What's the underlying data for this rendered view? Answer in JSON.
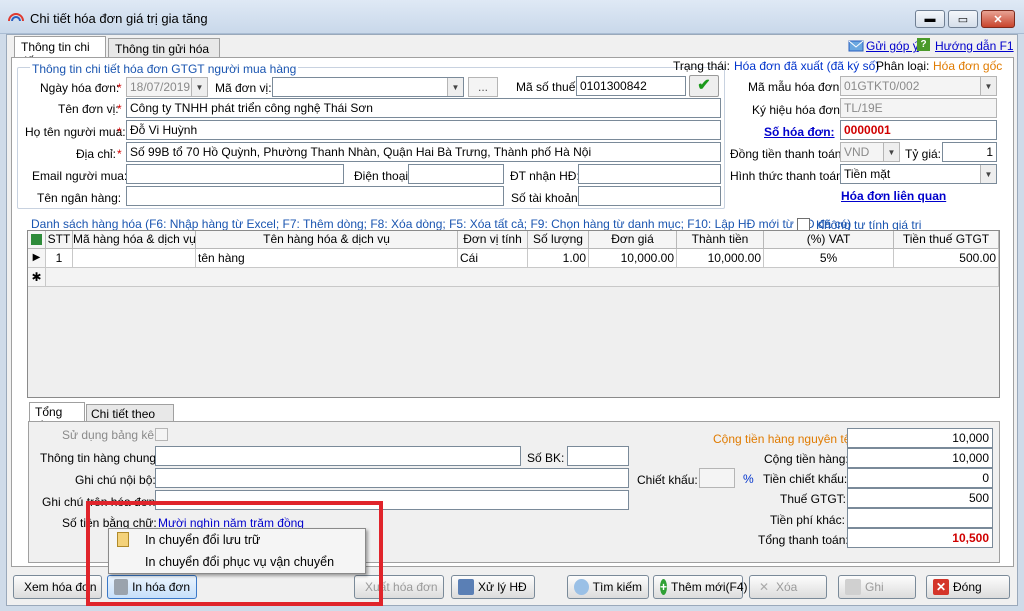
{
  "window": {
    "title": "Chi tiết hóa đơn giá trị gia tăng",
    "min": "▬",
    "max": "▭",
    "close": "✕"
  },
  "tabs": [
    "Thông tin chi tiết",
    "Thông tin gửi hóa đơn"
  ],
  "header_links": {
    "feedback": "Gửi góp ý",
    "help": "Hướng dẫn F1"
  },
  "buyer_group": {
    "title": "Thông tin chi tiết hóa đơn GTGT người mua hàng",
    "invoice_date_label": "Ngày hóa đơn:",
    "invoice_date": "18/07/2019",
    "unit_code_label": "Mã đơn vị:",
    "unit_code": "",
    "lookup_btn": "...",
    "tax_code_label": "Mã số thuế:",
    "tax_code": "0101300842",
    "unit_name_label": "Tên đơn vị:",
    "unit_name": "Công ty TNHH phát triển công nghệ Thái Sơn",
    "buyer_name_label": "Họ tên người mua:",
    "buyer_name": "Đỗ Vi Huỳnh",
    "address_label": "Địa chỉ:",
    "address": "Số 99B tổ 70 Hồ Quỳnh, Phường Thanh Nhàn, Quận Hai Bà Trưng, Thành phố Hà Nội",
    "email_label": "Email người mua:",
    "email": "",
    "phone_label": "Điện thoại:",
    "phone": "",
    "recv_phone_label": "ĐT nhận HĐ:",
    "recv_phone": "",
    "bank_name_label": "Tên ngân hàng:",
    "bank_name": "",
    "account_label": "Số tài khoản:",
    "account": "",
    "required_mark": "*"
  },
  "status": {
    "label": "Trạng thái:",
    "value": "Hóa đơn đã xuất (đã ký số)",
    "class_label": "Phân loại:",
    "class_value": "Hóa đơn gốc"
  },
  "right_panel": {
    "template_label": "Mã mẫu hóa đơn:",
    "template": "01GTKT0/002",
    "series_label": "Ký hiệu hóa đơn:",
    "series": "TL/19E",
    "number_label": "Số hóa đơn:",
    "number": "0000001",
    "currency_label": "Đồng tiền thanh toán:",
    "currency": "VND",
    "rate_label": "Tỷ giá:",
    "rate": "1",
    "payment_label": "Hình thức thanh toán:",
    "payment": "Tiền mặt",
    "related_link": "Hóa đơn liên quan"
  },
  "goods": {
    "title": "Danh sách hàng hóa (F6: Nhập hàng từ Excel; F7: Thêm dòng; F8: Xóa dòng; F5: Xóa tất cả; F9: Chọn hàng từ danh mục; F10: Lập HĐ mới từ HĐ đã có)",
    "no_auto_calc": "Không tự tính giá trị",
    "columns": [
      "STT",
      "Mã hàng hóa & dịch vụ",
      "Tên hàng hóa & dịch vụ",
      "Đơn vị tính",
      "Số lượng",
      "Đơn giá",
      "Thành tiền",
      "(%) VAT",
      "Tiền thuế GTGT"
    ],
    "rows": [
      [
        "1",
        "",
        "tên hàng",
        "Cái",
        "1.00",
        "10,000.00",
        "10,000.00",
        "5%",
        "500.00"
      ]
    ],
    "current_marker": "▶",
    "new_marker": "✱"
  },
  "bottom_tabs": [
    "Tổng tiền",
    "Chi tiết theo thuế"
  ],
  "totals": {
    "use_list_label": "Sử dụng bảng kê:",
    "general_info_label": "Thông tin hàng chung:",
    "general_info": "",
    "bk_label": "Số BK:",
    "bk": "",
    "internal_note_label": "Ghi chú nội bộ:",
    "internal_note": "",
    "invoice_note_label": "Ghi chú trên hóa đơn:",
    "invoice_note": "",
    "in_words_label": "Số tiền bằng chữ:",
    "in_words": "Mười nghìn năm trăm đồng",
    "discount_label": "Chiết khấu:",
    "discount": "",
    "percent": "%",
    "orig_goods_label": "Cộng tiền hàng nguyên tệ:",
    "orig_goods": "10,000",
    "goods_label": "Cộng tiền hàng:",
    "goods": "10,000",
    "discount_amount_label": "Tiền chiết khấu:",
    "discount_amount": "0",
    "vat_label": "Thuế GTGT:",
    "vat": "500",
    "other_fee_label": "Tiền phí khác:",
    "other_fee": "",
    "total_label": "Tổng thanh toán:",
    "total": "10,500"
  },
  "context_menu": [
    "In chuyển đổi lưu trữ",
    "In chuyển đổi phục vụ vận chuyển"
  ],
  "buttons": {
    "view": "Xem hóa đơn",
    "print": "In hóa đơn",
    "export": "Xuất hóa đơn",
    "process": "Xử lý HĐ",
    "search": "Tìm kiếm",
    "add": "Thêm mới(F4)",
    "delete": "Xóa",
    "save": "Ghi",
    "close": "Đóng"
  },
  "colors": {
    "accent_red": "#e0242b",
    "link_blue": "#0000cc",
    "status_orange": "#e07b00"
  }
}
